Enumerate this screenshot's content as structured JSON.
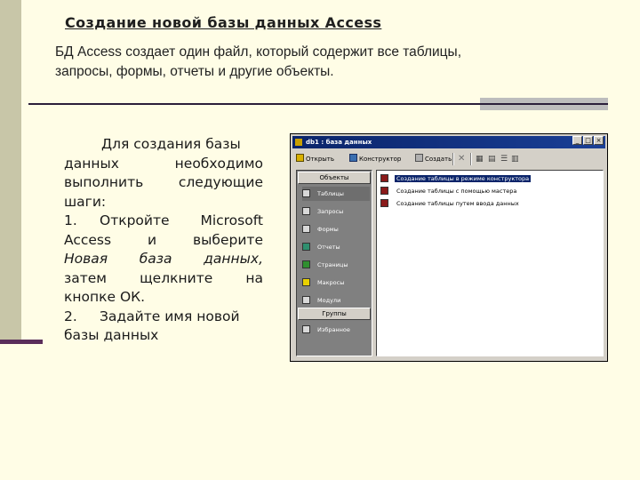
{
  "slide": {
    "title": "Создание новой базы данных Access ",
    "subtitle_line1": "БД Access создает один файл, который содержит все таблицы,",
    "subtitle_line2": "запросы, формы, отчеты и другие объекты."
  },
  "instructions": {
    "l1": "Для создания базы",
    "l2a": "данных",
    "l2b": "необходимо",
    "l3a": "выполнить",
    "l3b": "следующие",
    "l4": "шаги:",
    "l5_num": "1.",
    "l5a": "Откройте",
    "l5b": "Microsoft",
    "l6a": "Access",
    "l6b": "и",
    "l6c": "выберите",
    "l7a": "Новая",
    "l7b": "база",
    "l7c": "данных,",
    "l8a": "затем",
    "l8b": "щелкните",
    "l8c": "на",
    "l9": "кнопке ОК.",
    "l10_num": "2.",
    "l10": "Задайте имя новой",
    "l11": "базы данных"
  },
  "access_window": {
    "title": "db1 : база данных",
    "toolbar": {
      "open": "Открыть",
      "design": "Конструктор",
      "create": "Создать"
    },
    "objects_header": "Объекты",
    "groups_header": "Группы",
    "objects": [
      {
        "label": "Таблицы",
        "icon": "table-icon",
        "color": "#d8d8d8"
      },
      {
        "label": "Запросы",
        "icon": "query-icon",
        "color": "#d8d8d8"
      },
      {
        "label": "Формы",
        "icon": "form-icon",
        "color": "#d8d8d8"
      },
      {
        "label": "Отчеты",
        "icon": "report-icon",
        "color": "#2f8f6f"
      },
      {
        "label": "Страницы",
        "icon": "page-icon",
        "color": "#2f8f2f"
      },
      {
        "label": "Макросы",
        "icon": "macro-icon",
        "color": "#e8d000"
      },
      {
        "label": "Модули",
        "icon": "module-icon",
        "color": "#d8d8d8"
      }
    ],
    "favorites": "Избранное",
    "list": [
      "Создание таблицы в режиме конструктора",
      "Создание таблицы с помощью мастера",
      "Создание таблицы путем ввода данных"
    ]
  },
  "colors": {
    "background": "#fffde6",
    "left_band": "#c8c6a8",
    "rule": "#2b1f3a",
    "titlebar": "#0a246a",
    "selection": "#0a246a"
  }
}
